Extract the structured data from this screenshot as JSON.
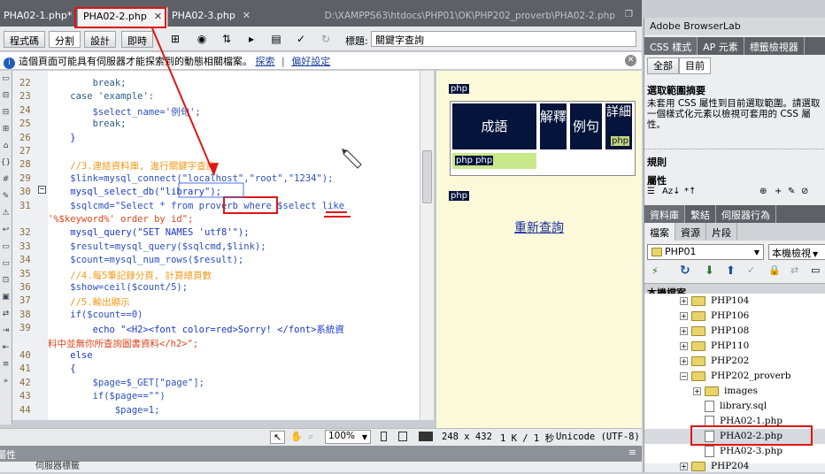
{
  "tabs": [
    {
      "label": "PHA02-1.php*",
      "active": false
    },
    {
      "label": "PHA02-2.php",
      "active": true
    },
    {
      "label": "PHA02-3.php",
      "active": false
    }
  ],
  "doc_path": "D:\\XAMPPS63\\htdocs\\PHP01\\OK\\PHP202_proverb\\PHA02-2.php",
  "toolbar": {
    "code_view": "程式碼",
    "split_view": "分割",
    "design_view": "設計",
    "live_view": "即時",
    "title_label": "標題:",
    "title_value": "關鍵字查詢"
  },
  "infobar": {
    "message": "這個頁面可能具有伺服器才能探索到的動態相關檔案。",
    "link1": "探索",
    "sep": "|",
    "link2": "偏好設定"
  },
  "code_lines": [
    {
      "n": "22",
      "t": "        break;"
    },
    {
      "n": "23",
      "t": "    case 'example':"
    },
    {
      "n": "24",
      "t": "        $select_name='例句';"
    },
    {
      "n": "25",
      "t": "        break;"
    },
    {
      "n": "26",
      "t": "    }"
    },
    {
      "n": "27",
      "t": ""
    },
    {
      "n": "28",
      "t": "    //3.連結資料庫, 進行關鍵字查詢"
    },
    {
      "n": "29",
      "t": "    $link=mysql_connect(\"localhost\",\"root\",\"1234\");"
    },
    {
      "n": "30",
      "t": "    mysql_select_db(\"library\");"
    },
    {
      "n": "31",
      "t": "    $sqlcmd=\"Select * from proverb where $select like"
    },
    {
      "n": "",
      "t": "'%$keyword%' order by id\";"
    },
    {
      "n": "32",
      "t": "    mysql_query(\"SET NAMES 'utf8'\");"
    },
    {
      "n": "33",
      "t": "    $result=mysql_query($sqlcmd,$link);"
    },
    {
      "n": "34",
      "t": "    $count=mysql_num_rows($result);"
    },
    {
      "n": "35",
      "t": "    //4.每5筆記錄分頁, 計算總頁數"
    },
    {
      "n": "36",
      "t": "    $show=ceil($count/5);"
    },
    {
      "n": "37",
      "t": "    //5.輸出顯示"
    },
    {
      "n": "38",
      "t": "    if($count==0)"
    },
    {
      "n": "39",
      "t": "        echo \"<H2><font color=red>Sorry! </font>系統資"
    },
    {
      "n": "",
      "t": "料中並無你所查詢圖書資料</h2>\";"
    },
    {
      "n": "40",
      "t": "    else"
    },
    {
      "n": "41",
      "t": "    {"
    },
    {
      "n": "42",
      "t": "        $page=$_GET[\"page\"];"
    },
    {
      "n": "43",
      "t": "        if($page==\"\")"
    },
    {
      "n": "44",
      "t": "            $page=1;"
    }
  ],
  "design": {
    "php_tag": "php",
    "header_cells": [
      "成語",
      "解釋",
      "例句",
      "詳細"
    ],
    "detail_tag": "php",
    "row_tags": "php php",
    "php_tag2": "php",
    "requery_link": "重新查詢"
  },
  "status": {
    "zoom": "100%",
    "size": "248 x 432",
    "filesize": "1 K / 1 秒",
    "encoding": "Unicode (UTF-8)"
  },
  "bottom_panel": {
    "label": "屬性",
    "sub": "伺服器標籤"
  },
  "right": {
    "browserlab": "Adobe BrowserLab",
    "css_tabs": [
      "CSS 樣式",
      "AP 元素",
      "標籤檢視器"
    ],
    "mode_tabs": [
      "全部",
      "目前"
    ],
    "summary_title": "選取範圍摘要",
    "summary_text": "未套用 CSS 屬性到目前選取範圍。請選取一個樣式化元素以檢視可套用的 CSS 屬性。",
    "rules": "規則",
    "props": "屬性",
    "lib_tabs": [
      "資料庫",
      "繫結",
      "伺服器行為"
    ],
    "file_tabs": [
      "檔案",
      "資源",
      "片段"
    ],
    "site": "PHP01",
    "view": "本機檢視",
    "local_files": "本機檔案",
    "tree": [
      {
        "label": "PHP104",
        "type": "folder",
        "level": 1
      },
      {
        "label": "PHP106",
        "type": "folder",
        "level": 1
      },
      {
        "label": "PHP108",
        "type": "folder",
        "level": 1
      },
      {
        "label": "PHP110",
        "type": "folder",
        "level": 1
      },
      {
        "label": "PHP202",
        "type": "folder",
        "level": 1
      },
      {
        "label": "PHP202_proverb",
        "type": "folder",
        "level": 1,
        "open": true
      },
      {
        "label": "images",
        "type": "folder",
        "level": 2
      },
      {
        "label": "library.sql",
        "type": "file",
        "level": 2
      },
      {
        "label": "PHA02-1.php",
        "type": "file",
        "level": 2
      },
      {
        "label": "PHA02-2.php",
        "type": "file",
        "level": 2,
        "selected": true
      },
      {
        "label": "PHA02-3.php",
        "type": "file",
        "level": 2
      },
      {
        "label": "PHP204",
        "type": "folder",
        "level": 1
      }
    ]
  },
  "colors": {
    "accent_red": "#e01515",
    "navy": "#04143a",
    "design_bg": "#fbf9d9"
  }
}
